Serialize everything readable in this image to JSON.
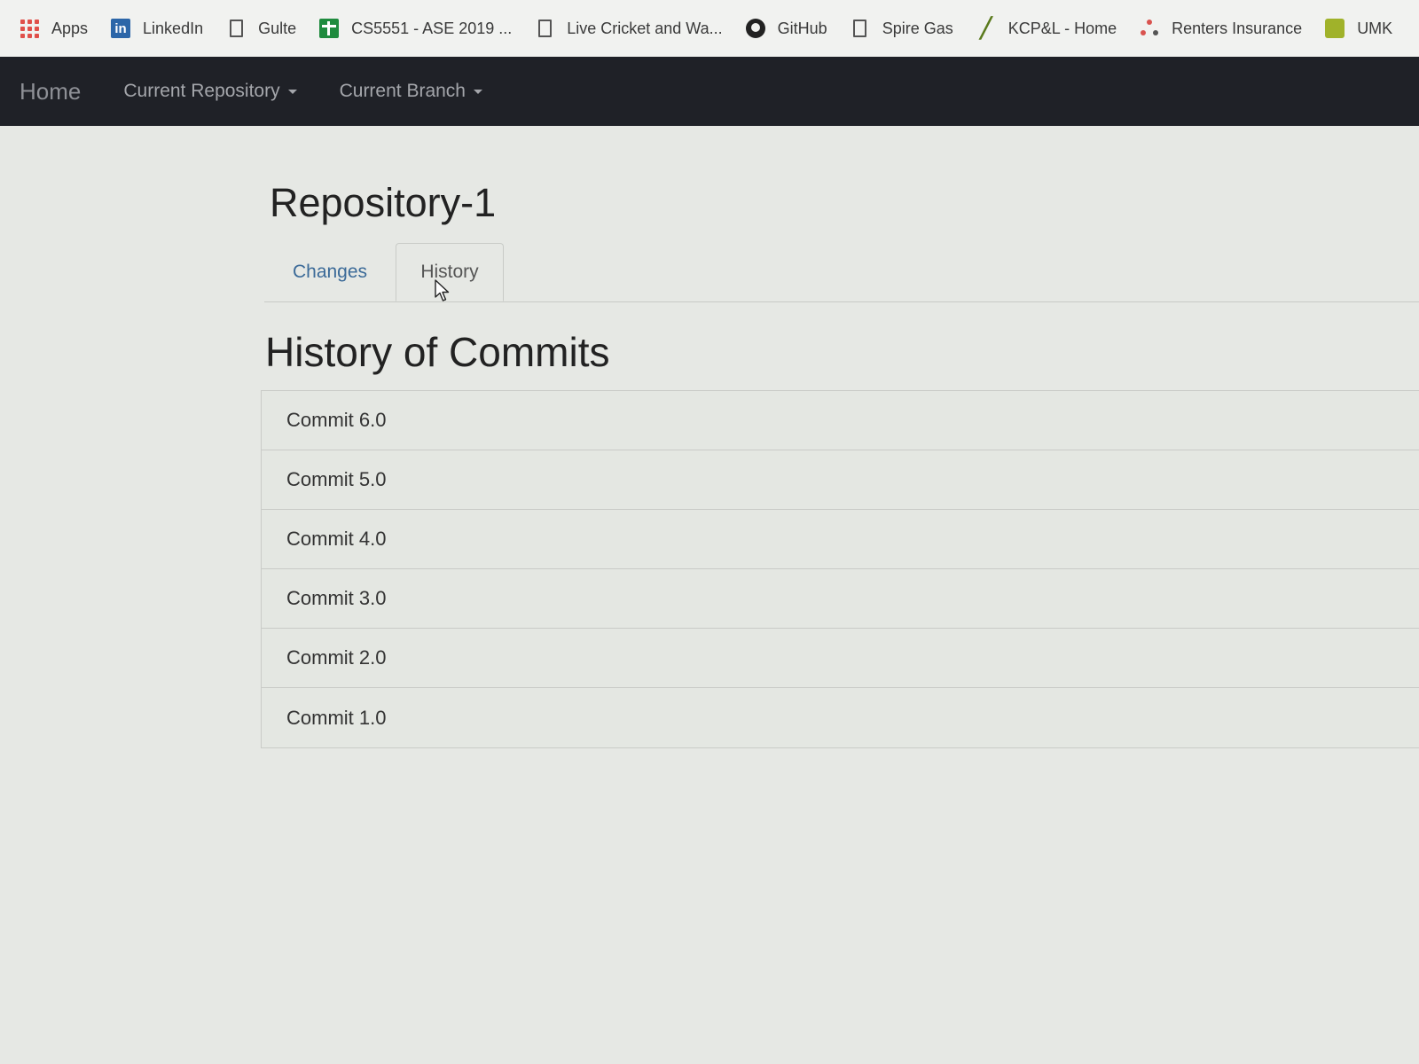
{
  "bookmarks": [
    {
      "label": "Apps",
      "icon": "apps-grid-icon"
    },
    {
      "label": "LinkedIn",
      "icon": "linkedin-icon"
    },
    {
      "label": "Gulte",
      "icon": "page-icon"
    },
    {
      "label": "CS5551 - ASE 2019 ...",
      "icon": "sheets-icon"
    },
    {
      "label": "Live Cricket and Wa...",
      "icon": "page-icon"
    },
    {
      "label": "GitHub",
      "icon": "github-icon"
    },
    {
      "label": "Spire Gas",
      "icon": "page-icon"
    },
    {
      "label": "KCP&L - Home",
      "icon": "kcpl-icon"
    },
    {
      "label": "Renters Insurance",
      "icon": "dots-icon"
    },
    {
      "label": "UMK",
      "icon": "umkc-icon"
    }
  ],
  "navbar": {
    "brand": "Home",
    "items": [
      {
        "label": "Current Repository"
      },
      {
        "label": "Current Branch"
      }
    ]
  },
  "repo": {
    "title": "Repository-1"
  },
  "tabs": [
    {
      "label": "Changes"
    },
    {
      "label": "History"
    }
  ],
  "history": {
    "title": "History of Commits",
    "commits": [
      {
        "label": "Commit 6.0"
      },
      {
        "label": "Commit 5.0"
      },
      {
        "label": "Commit 4.0"
      },
      {
        "label": "Commit 3.0"
      },
      {
        "label": "Commit 2.0"
      },
      {
        "label": "Commit 1.0"
      }
    ]
  },
  "colors": {
    "navbar_bg": "#1f2127",
    "page_bg": "#e6e8e4",
    "tab_link": "#3b6a98"
  }
}
